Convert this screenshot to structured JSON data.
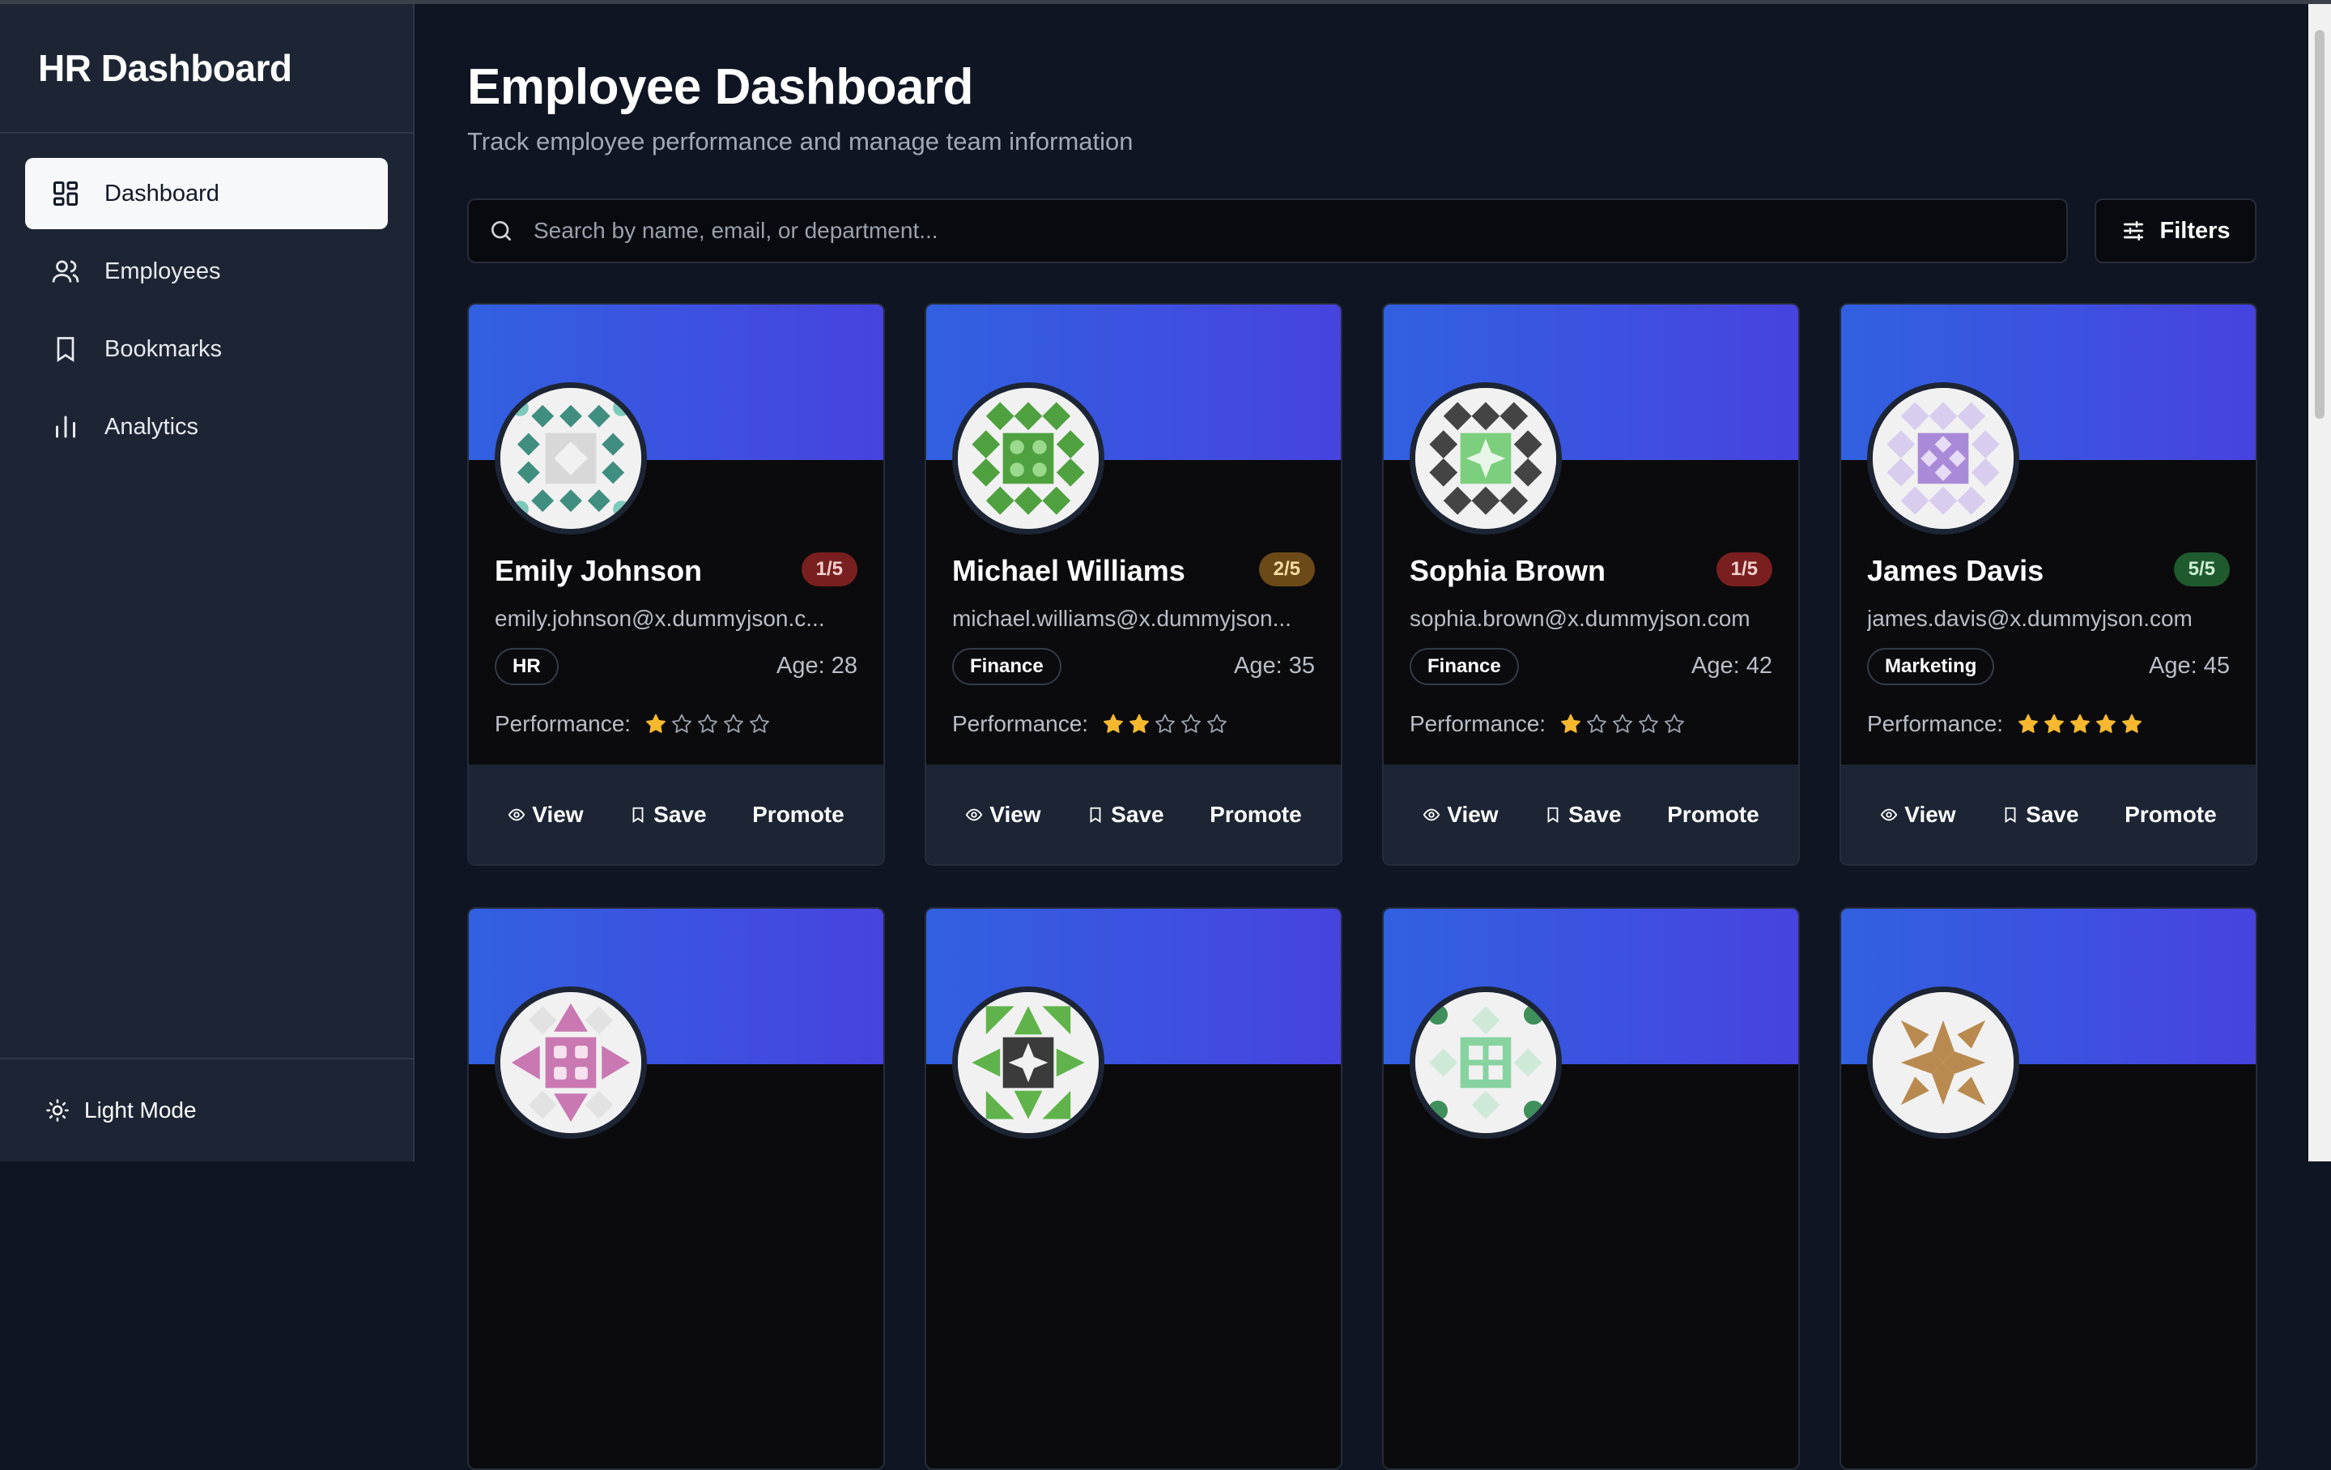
{
  "sidebar": {
    "brand": "HR Dashboard",
    "items": [
      {
        "label": "Dashboard",
        "icon": "dashboard-icon",
        "active": true
      },
      {
        "label": "Employees",
        "icon": "users-icon"
      },
      {
        "label": "Bookmarks",
        "icon": "bookmark-icon"
      },
      {
        "label": "Analytics",
        "icon": "bar-chart-icon"
      }
    ],
    "footer_label": "Light Mode"
  },
  "main": {
    "title": "Employee Dashboard",
    "subtitle": "Track employee performance and manage team information",
    "search_placeholder": "Search by name, email, or department...",
    "filters_label": "Filters"
  },
  "card_actions": {
    "view": "View",
    "save": "Save",
    "promote": "Promote"
  },
  "colors": {
    "banner_start": "#3161e0",
    "banner_end": "#4743df",
    "star": "#f5b82e"
  },
  "employees": [
    {
      "name": "Emily Johnson",
      "email": "emily.johnson@x.dummyjson.c...",
      "department": "HR",
      "age": "Age: 28",
      "rating_label": "1/5",
      "rating": 1,
      "performance_label": "Performance:"
    },
    {
      "name": "Michael Williams",
      "email": "michael.williams@x.dummyjson...",
      "department": "Finance",
      "age": "Age: 35",
      "rating_label": "2/5",
      "rating": 2,
      "performance_label": "Performance:"
    },
    {
      "name": "Sophia Brown",
      "email": "sophia.brown@x.dummyjson.com",
      "department": "Finance",
      "age": "Age: 42",
      "rating_label": "1/5",
      "rating": 1,
      "performance_label": "Performance:"
    },
    {
      "name": "James Davis",
      "email": "james.davis@x.dummyjson.com",
      "department": "Marketing",
      "age": "Age: 45",
      "rating_label": "5/5",
      "rating": 5,
      "performance_label": "Performance:"
    }
  ]
}
